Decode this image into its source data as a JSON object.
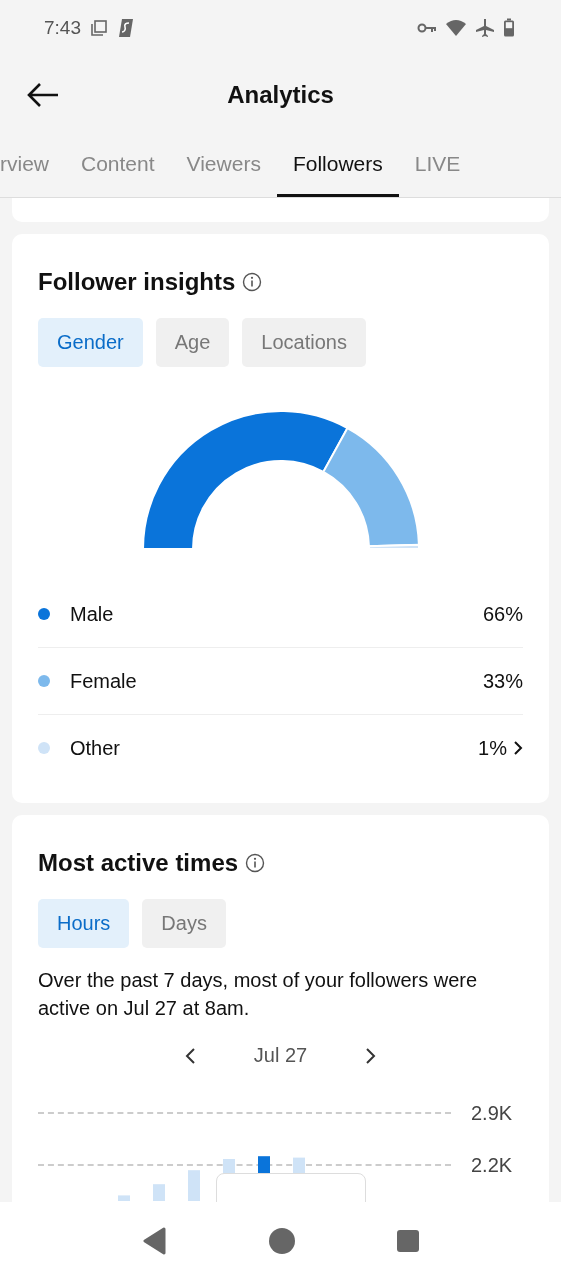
{
  "status_bar": {
    "time": "7:43"
  },
  "header": {
    "title": "Analytics"
  },
  "tabs": [
    {
      "label": "rview",
      "selected": false
    },
    {
      "label": "Content",
      "selected": false
    },
    {
      "label": "Viewers",
      "selected": false
    },
    {
      "label": "Followers",
      "selected": true
    },
    {
      "label": "LIVE",
      "selected": false
    }
  ],
  "follower_insights": {
    "title": "Follower insights",
    "filters": [
      {
        "label": "Gender",
        "selected": true
      },
      {
        "label": "Age",
        "selected": false
      },
      {
        "label": "Locations",
        "selected": false
      }
    ],
    "legend": [
      {
        "label": "Male",
        "value": "66%",
        "color": "#0a74da",
        "chevron": false
      },
      {
        "label": "Female",
        "value": "33%",
        "color": "#7db9ec",
        "chevron": false
      },
      {
        "label": "Other",
        "value": "1%",
        "color": "#cfe3f7",
        "chevron": true
      }
    ]
  },
  "most_active_times": {
    "title": "Most active times",
    "filters": [
      {
        "label": "Hours",
        "selected": true
      },
      {
        "label": "Days",
        "selected": false
      }
    ],
    "summary": "Over the past 7 days, most of your followers were active on Jul 27 at 8am.",
    "date": "Jul 27",
    "axis_labels": [
      "2.9K",
      "2.2K"
    ]
  }
}
